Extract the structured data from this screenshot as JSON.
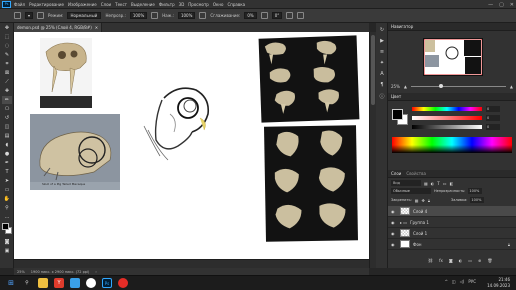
{
  "menubar": {
    "ps_logo": "Ps",
    "items": [
      "Файл",
      "Редактирование",
      "Изображение",
      "Слои",
      "Текст",
      "Выделение",
      "Фильтр",
      "3D",
      "Просмотр",
      "Окно",
      "Справка"
    ]
  },
  "options": {
    "mode_label": "Режим:",
    "mode_value": "Нормальный",
    "opacity_label": "Непрозр.:",
    "opacity_value": "100%",
    "pressure_label": "Наж.:",
    "pressure_value": "100%",
    "smoothing_label": "Сглаживание:",
    "smoothing_value": "0%",
    "angle_value": "0°"
  },
  "document": {
    "tab_title": "demon.psd @ 25% (Слой 4, RGB/8#)",
    "zoom": "25%",
    "doc_info": "1900 пикс. x 2900 пикс. (72 ppi)"
  },
  "canvas_image": {
    "caption": "Skull of a Pig Tailed Macaque"
  },
  "navigator": {
    "title": "Навигатор",
    "zoom": "25%"
  },
  "color_panel": {
    "tab_color": "Цвет",
    "hue_value": "0",
    "sat_value": "0",
    "bri_value": "0"
  },
  "layers_panel": {
    "tab_layers": "Слои",
    "tab_properties": "Свойства",
    "search_placeholder": "Вид",
    "blend_mode": "Обычные",
    "opacity_label": "Непрозрачность:",
    "opacity_value": "100%",
    "lock_label": "Закрепить:",
    "fill_label": "Заливка:",
    "fill_value": "100%",
    "layers": [
      {
        "name": "Слой 4",
        "selected": true
      },
      {
        "name": "Группа 1",
        "selected": false
      },
      {
        "name": "Слой 1",
        "selected": false
      },
      {
        "name": "Фон",
        "selected": false
      }
    ]
  },
  "taskbar": {
    "time": "21:46",
    "date": "14.09.2023",
    "lang": "РУС"
  },
  "colors": {
    "accent": "#1473e6",
    "panel": "#323232",
    "canvas": "#ffffff"
  }
}
